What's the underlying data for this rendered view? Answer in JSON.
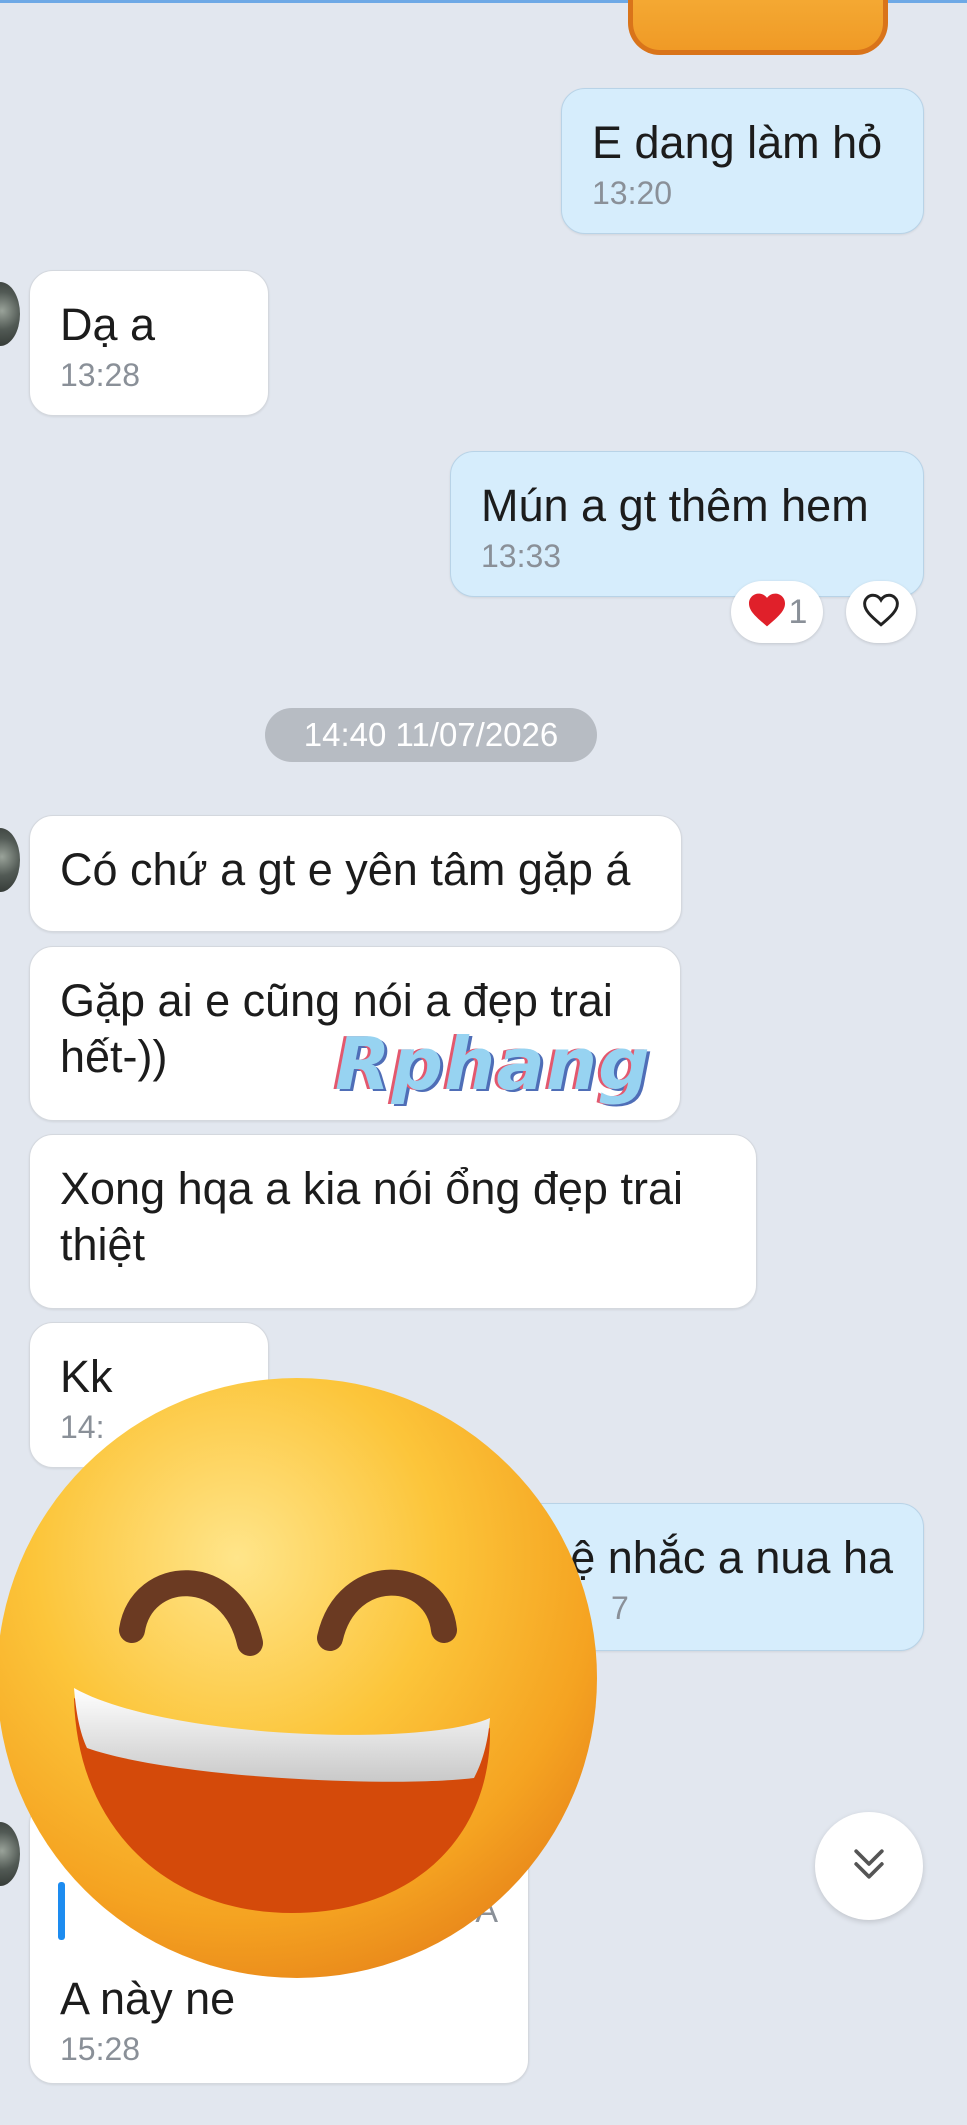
{
  "messages": [
    {
      "text": "E dang làm hỏ",
      "time": "13:20"
    },
    {
      "text": "Dạ a",
      "time": "13:28"
    },
    {
      "text": "Mún a gt thêm hem",
      "time": "13:33",
      "reaction_count": "1"
    },
    {
      "text": "Có chứ a gt e yên tâm gặp á"
    },
    {
      "text": "Gặp ai e cũng nói a đẹp trai hết-))"
    },
    {
      "text": "Xong hqa a kia nói ổng đẹp trai thiệt"
    },
    {
      "text": "Kk",
      "time": "14:"
    },
    {
      "text": "ệ nhắc a nua ha",
      "time": "7"
    },
    {
      "text": "A này ne",
      "time": "15:28",
      "reply_fragment": "A"
    }
  ],
  "date_separator": "14:40 11/07/2026",
  "watermark": "Rphang",
  "icons": {
    "heart_filled": "heart-filled-icon",
    "heart_outline": "heart-outline-icon",
    "scroll_down": "double-chevron-down-icon",
    "emoji": "grinning-face-emoji"
  },
  "colors": {
    "background": "#e2e7ef",
    "incoming_bubble": "#ffffff",
    "outgoing_bubble": "#d6edfc",
    "heart": "#e0202a"
  }
}
